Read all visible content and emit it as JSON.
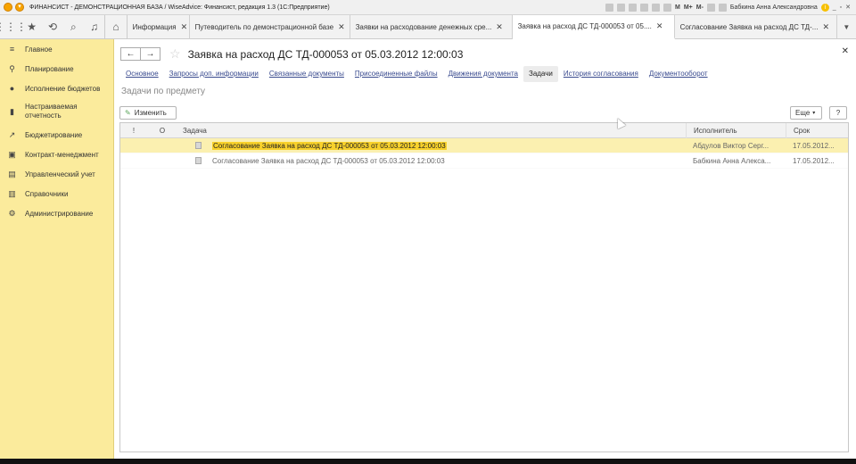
{
  "titlebar": {
    "title": "ФИНАНСИСТ - ДЕМОНСТРАЦИОННАЯ БАЗА / WiseAdvice: Финансист, редакция 1.3  (1С:Предприятие)",
    "user": "Бабкина Анна Александровна",
    "m1": "M",
    "m2": "M+",
    "m3": "M-",
    "info": "i"
  },
  "tabs": [
    {
      "label": "Информация"
    },
    {
      "label": "Путеводитель по демонстрационной базе"
    },
    {
      "label": "Заявки на расходование денежных сре..."
    },
    {
      "label": "Заявка на расход ДС ТД-000053 от 05...."
    },
    {
      "label": "Согласование Заявка на расход ДС ТД-..."
    }
  ],
  "sidebar": {
    "items": [
      {
        "label": "Главное",
        "icon": "≡"
      },
      {
        "label": "Планирование",
        "icon": "⚲"
      },
      {
        "label": "Исполнение бюджетов",
        "icon": "●"
      },
      {
        "label": "Настраиваемая отчетность",
        "icon": "▮"
      },
      {
        "label": "Бюджетирование",
        "icon": "↗"
      },
      {
        "label": "Контракт-менеджмент",
        "icon": "▣"
      },
      {
        "label": "Управленческий учет",
        "icon": "▤"
      },
      {
        "label": "Справочники",
        "icon": "▥"
      },
      {
        "label": "Администрирование",
        "icon": "⚙"
      }
    ]
  },
  "document": {
    "title": "Заявка на расход ДС ТД-000053 от 05.03.2012 12:00:03",
    "links": [
      {
        "label": "Основное"
      },
      {
        "label": "Запросы доп. информации"
      },
      {
        "label": "Связанные документы"
      },
      {
        "label": "Присоединенные файлы"
      },
      {
        "label": "Движения документа"
      },
      {
        "label": "Задачи"
      },
      {
        "label": "История согласования"
      },
      {
        "label": "Документооборот"
      }
    ],
    "section_title": "Задачи по предмету",
    "edit_button": "Изменить",
    "more_button": "Еще",
    "help_button": "?"
  },
  "grid": {
    "headers": {
      "importance": "!",
      "status": "O",
      "task": "Задача",
      "executor": "Исполнитель",
      "deadline": "Срок"
    },
    "rows": [
      {
        "task": "Согласование Заявка на расход ДС ТД-000053 от 05.03.2012 12:00:03",
        "executor": "Абдулов Виктор Серг...",
        "deadline": "17.05.2012..."
      },
      {
        "task": "Согласование Заявка на расход ДС ТД-000053 от 05.03.2012 12:00:03",
        "executor": "Бабкина Анна Алекса...",
        "deadline": "17.05.2012..."
      }
    ]
  },
  "colors": {
    "sidebar_bg": "#fbeb9c",
    "selected_row": "#fbf0b0",
    "highlight": "#f8d12b",
    "link": "#3a4b8f"
  }
}
